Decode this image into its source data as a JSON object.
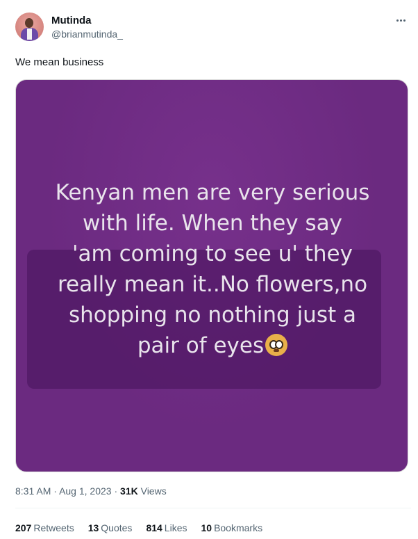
{
  "author": {
    "display_name": "Mutinda",
    "handle": "@brianmutinda_"
  },
  "tweet": {
    "text": "We mean business",
    "image_text": "Kenyan men are very serious with life. When they say 'am coming to see u' they really mean it..No flowers,no shopping no nothing just a pair of eyes",
    "image_lines": [
      "Kenyan men are very serious",
      "with life. When they say",
      "'am coming to see u' they",
      "really mean it..No flowers,no",
      "shopping no nothing just a",
      "pair of eyes"
    ],
    "image_emoji": "flushed-face-icon"
  },
  "meta": {
    "time": "8:31 AM",
    "date": "Aug 1, 2023",
    "separator": "·",
    "views_count": "31K",
    "views_label": "Views"
  },
  "stats": [
    {
      "count": "207",
      "label": "Retweets"
    },
    {
      "count": "13",
      "label": "Quotes"
    },
    {
      "count": "814",
      "label": "Likes"
    },
    {
      "count": "10",
      "label": "Bookmarks"
    }
  ],
  "colors": {
    "media_bg": "#6b2a80",
    "media_text": "#e9e4ec",
    "secondary_text": "#536471",
    "primary_text": "#0f1419"
  }
}
